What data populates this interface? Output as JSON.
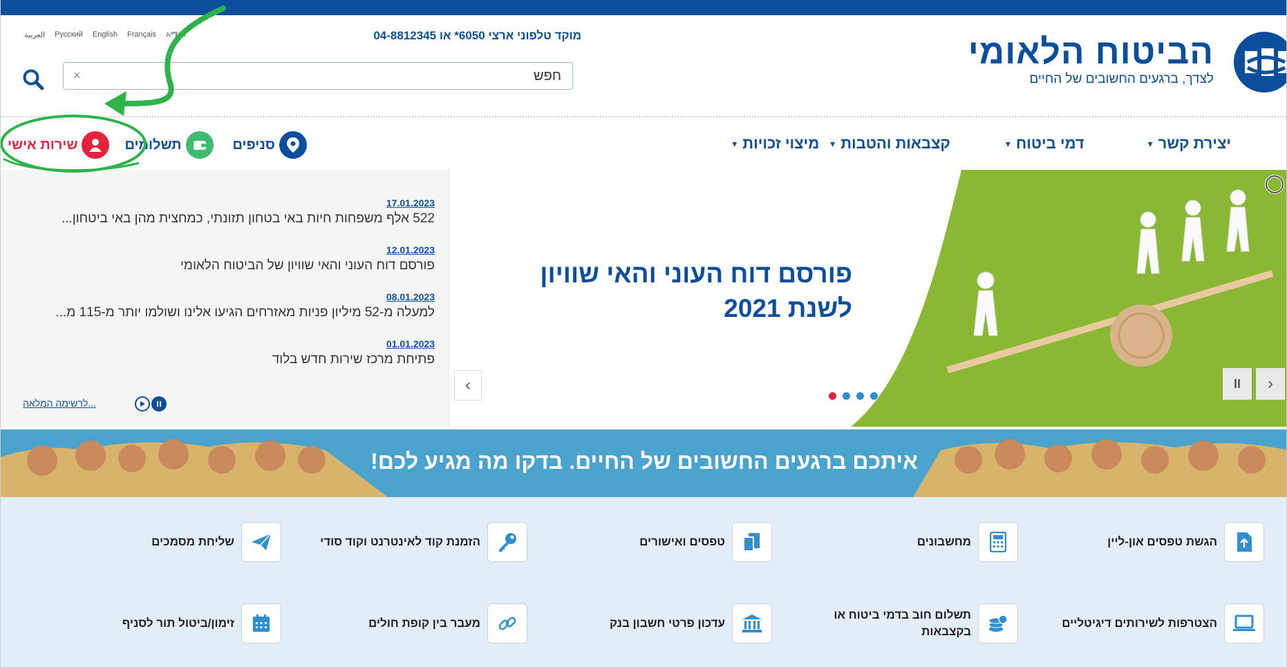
{
  "languages": [
    "العربية",
    "Русский",
    "English",
    "Français",
    "አማርኛ"
  ],
  "header": {
    "phone": "מוקד טלפוני ארצי 6050* או 04-8812345",
    "search_placeholder": "חפש",
    "search_clear": "×"
  },
  "logo": {
    "title": "הביטוח הלאומי",
    "tagline": "לצדך, ברגעים החשובים של החיים"
  },
  "nav": {
    "items": [
      {
        "label": "מיצוי זכויות"
      },
      {
        "label": "קצבאות והטבות"
      },
      {
        "label": "דמי ביטוח"
      },
      {
        "label": "יצירת קשר"
      }
    ],
    "caret": "▾"
  },
  "quick_links": [
    {
      "label": "סניפים",
      "icon": "location-pin-icon",
      "color": "#0b4f9c"
    },
    {
      "label": "תשלומים",
      "icon": "wallet-icon",
      "color": "#3dbb6e"
    },
    {
      "label": "שירות אישי",
      "icon": "user-icon",
      "color": "#e0243b"
    }
  ],
  "news": {
    "items": [
      {
        "date": "17.01.2023",
        "text": "522 אלף משפחות חיות באי בטחון תזונתי, כמחצית מהן באי ביטחון..."
      },
      {
        "date": "12.01.2023",
        "text": "פורסם דוח העוני והאי שוויון של הביטוח הלאומי"
      },
      {
        "date": "08.01.2023",
        "text": "למעלה מ-52 מיליון פניות מאזרחים הגיעו אלינו ושולמו יותר מ-115 מ..."
      },
      {
        "date": "01.01.2023",
        "text": "פתיחת מרכז שירות חדש בלוד"
      }
    ],
    "all_link": "לרשימה המלאה..."
  },
  "hero": {
    "title_line1": "פורסם דוח העוני והאי שוויון",
    "title_line2": "לשנת 2021",
    "slide_count": 4,
    "active_slide": 1,
    "prev": "‹",
    "next": "›",
    "pause": "II"
  },
  "banner": {
    "text": "איתכם ברגעים החשובים של החיים. בדקו מה מגיע לכם!"
  },
  "services": [
    {
      "label": "הגשת טפסים און-ליין",
      "icon": "file-upload-icon"
    },
    {
      "label": "מחשבונים",
      "icon": "calculator-icon"
    },
    {
      "label": "טפסים ואישורים",
      "icon": "documents-icon"
    },
    {
      "label": "הזמנת קוד לאינטרנט וקוד סודי",
      "icon": "key-icon"
    },
    {
      "label": "שליחת מסמכים",
      "icon": "paper-plane-icon"
    },
    {
      "label": "הצטרפות לשירותים דיגיטליים",
      "icon": "laptop-icon"
    },
    {
      "label": "תשלום חוב בדמי ביטוח או בקצבאות",
      "icon": "coins-icon"
    },
    {
      "label": "עדכון פרטי חשבון בנק",
      "icon": "bank-icon"
    },
    {
      "label": "מעבר בין קופת חולים",
      "icon": "link-icon"
    },
    {
      "label": "זימון/ביטול תור לסניף",
      "icon": "calendar-icon"
    }
  ],
  "colors": {
    "brand_blue": "#0b4f9c",
    "hero_green": "#8ab834",
    "banner_blue": "#4aa3cc",
    "services_bg": "#e3edf8",
    "annotation_green": "#2db34a",
    "dot_active": "#e0243b",
    "dot_inactive": "#2f8fd0"
  }
}
